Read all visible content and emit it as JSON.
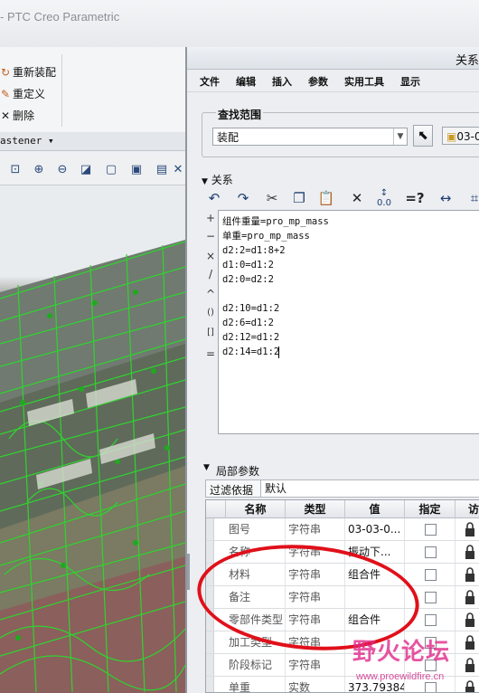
{
  "app_title": "- PTC Creo Parametric",
  "ribbon": {
    "reassemble": "重新装配",
    "redefine": "重定义",
    "delete": "删除",
    "fastener": "astener ▾"
  },
  "view_tools": [
    "zoom-fit-icon",
    "zoom-in-icon",
    "zoom-out-icon",
    "repaint-icon",
    "view-orient-icon",
    "saved-views-icon",
    "display-style-icon",
    "close-icon"
  ],
  "dialog": {
    "title": "关系",
    "menu": [
      "文件",
      "编辑",
      "插入",
      "参数",
      "实用工具",
      "显示"
    ],
    "search_scope": {
      "label": "查找范围",
      "value": "装配",
      "item": "03-0"
    },
    "relations_section": "关系",
    "operators": [
      "+",
      "−",
      "×",
      "/",
      "^",
      "()",
      "[]",
      "="
    ],
    "relations": [
      "组件重量=pro_mp_mass",
      "单重=pro_mp_mass",
      "d2:2=d1:8+2",
      "d1:0=d1:2",
      "d2:0=d2:2",
      "",
      "d2:10=d1:2",
      "d2:6=d1:2",
      "d2:12=d1:2",
      "d2:14=d1:2"
    ],
    "local_params": {
      "label": "局部参数",
      "filter_label": "过滤依据",
      "filter_value": "默认",
      "columns": [
        "名称",
        "类型",
        "值",
        "指定",
        "访"
      ],
      "rows": [
        {
          "name": "图号",
          "type": "字符串",
          "value": "03-03-0...",
          "designated": false
        },
        {
          "name": "名称",
          "type": "字符串",
          "value": "振动下...",
          "designated": false
        },
        {
          "name": "材料",
          "type": "字符串",
          "value": "组合件",
          "designated": false
        },
        {
          "name": "备注",
          "type": "字符串",
          "value": "",
          "designated": false
        },
        {
          "name": "零部件类型",
          "type": "字符串",
          "value": "组合件",
          "designated": false
        },
        {
          "name": "加工类型",
          "type": "字符串",
          "value": "",
          "designated": false
        },
        {
          "name": "阶段标记",
          "type": "字符串",
          "value": "",
          "designated": false
        },
        {
          "name": "单重",
          "type": "实数",
          "value": "373.793840",
          "designated": false
        }
      ]
    }
  },
  "watermark": {
    "text": "野火论坛",
    "url": "www.proewildfire.cn"
  }
}
